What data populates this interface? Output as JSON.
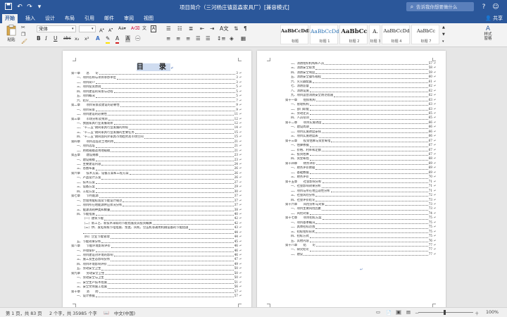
{
  "window": {
    "title": "项目简介（三河杨庄镇蓝森家具厂）[兼容模式]",
    "search_placeholder": "告诉我你想要做什么"
  },
  "tabs": [
    "开始",
    "插入",
    "设计",
    "布局",
    "引用",
    "邮件",
    "审阅",
    "视图"
  ],
  "active_tab": "开始",
  "share_label": "共享",
  "ribbon": {
    "paste_label": "粘贴",
    "font_name": "宋体",
    "font_size": "",
    "format_buttons": [
      "B",
      "I",
      "U",
      "abc",
      "x₂",
      "x²"
    ],
    "styles": [
      {
        "sample": "AaBbCcDdI",
        "name": "标题"
      },
      {
        "sample": "AaBbCcDd",
        "name": "标题 1"
      },
      {
        "sample": "AaBbCc",
        "name": "标题 2"
      },
      {
        "sample": "A.",
        "name": "标题 3"
      },
      {
        "sample": "AaBbCcDd",
        "name": "标题 4"
      },
      {
        "sample": "AaBbCc",
        "name": "标题 7"
      }
    ],
    "side_pane": "样式\n窗格"
  },
  "page1": {
    "title": "目　录",
    "entries": [
      {
        "t": "第一章　　总　　论",
        "p": "3",
        "lv": 0
      },
      {
        "t": "一、项目名称与项目承办单位",
        "p": "3",
        "lv": 1
      },
      {
        "t": "二、项目简介",
        "p": "3",
        "lv": 1
      },
      {
        "t": "三、项目投资原则",
        "p": "5",
        "lv": 1
      },
      {
        "t": "四、项目建设的背景与过程",
        "p": "5",
        "lv": 1
      },
      {
        "t": "五、项目概况",
        "p": "5",
        "lv": 1
      },
      {
        "t": "六、结论",
        "p": "7",
        "lv": 1
      },
      {
        "t": "第二章　　项目背景及建设的必要性",
        "p": "9",
        "lv": 0
      },
      {
        "t": "一、项目背景",
        "p": "9",
        "lv": 1
      },
      {
        "t": "二、项目建设的必要性",
        "p": "11",
        "lv": 1
      },
      {
        "t": "第三章　　市场分析及预测",
        "p": "12",
        "lv": 0
      },
      {
        "t": "一、我国家具行业发展现状",
        "p": "12",
        "lv": 1
      },
      {
        "t": "二、“十二五”期间家具行业发展的目标",
        "p": "14",
        "lv": 1
      },
      {
        "t": "三、“十二五”期间家具行业发展的主要任务",
        "p": "15",
        "lv": 1
      },
      {
        "t": "四、“十二五”期间国内外家具市场趋势及市场空间",
        "p": "15",
        "lv": 1
      },
      {
        "t": "第四章　　项目选址及土地利用",
        "p": "21",
        "lv": 0
      },
      {
        "t": "一、项目选址",
        "p": "21",
        "lv": 1
      },
      {
        "t": "二、用地规模及用地规模",
        "p": "21",
        "lv": 1
      },
      {
        "t": "第五章　　建设规模",
        "p": "23",
        "lv": 0
      },
      {
        "t": "一、建设规模",
        "p": "23",
        "lv": 1
      },
      {
        "t": "二、主要建设内容",
        "p": "24",
        "lv": 1
      },
      {
        "t": "三、总图布置",
        "p": "26",
        "lv": 1
      },
      {
        "t": "第六章　　技术方案、设备方案和工程方案",
        "p": "26",
        "lv": 0
      },
      {
        "t": "一、产品设计方案",
        "p": "26",
        "lv": 1
      },
      {
        "t": "二、技术方案",
        "p": "27",
        "lv": 1
      },
      {
        "t": "三、设备方案",
        "p": "29",
        "lv": 1
      },
      {
        "t": "四、工程方案",
        "p": "30",
        "lv": 1
      },
      {
        "t": "第七章　　节约能源",
        "p": "37",
        "lv": 0
      },
      {
        "t": "一、合理用能标准及节能设计规范",
        "p": "37",
        "lv": 1
      },
      {
        "t": "二、项目所在地能源供应状况分析",
        "p": "37",
        "lv": 1
      },
      {
        "t": "三、能源消耗种类和数量",
        "p": "38",
        "lv": 1
      },
      {
        "t": "四、节能措施",
        "p": "40",
        "lv": 1
      },
      {
        "t": "（一）建筑节能",
        "p": "42",
        "lv": 2
      },
      {
        "t": "（二）新工艺、新技术采取的节能措施及其投资概算",
        "p": "42",
        "lv": 2
      },
      {
        "t": "（三）供、发电系统节电措施、泵类、风机、空压机等通用机械设备的节能措施",
        "p": "43",
        "lv": 2
      },
      {
        "t": "",
        "p": "44",
        "lv": 2
      },
      {
        "t": "（四）企业节能管理",
        "p": "44",
        "lv": 2
      },
      {
        "t": "五、节能效果分析",
        "p": "45",
        "lv": 1
      },
      {
        "t": "第八章　　节能环境影响评价",
        "p": "46",
        "lv": 0
      },
      {
        "t": "一、环境保护",
        "p": "46",
        "lv": 1
      },
      {
        "t": "二、项目建设对环境的影响",
        "p": "46",
        "lv": 1
      },
      {
        "t": "三、施工及生态影响分析",
        "p": "47",
        "lv": 1
      },
      {
        "t": "四、项目环境影响评价",
        "p": "49",
        "lv": 1
      },
      {
        "t": "五、劳动安全卫生",
        "p": "50",
        "lv": 1
      },
      {
        "t": "第九章　　劳动安全卫生",
        "p": "50",
        "lv": 0
      },
      {
        "t": "一、劳动安全与卫生",
        "p": "50",
        "lv": 1
      },
      {
        "t": "二、安全生产技术措施",
        "p": "51",
        "lv": 1
      },
      {
        "t": "三、安全文明施工措施",
        "p": "56",
        "lv": 1
      },
      {
        "t": "第十章　　消　　防",
        "p": "57",
        "lv": 0
      },
      {
        "t": "一、设计依据",
        "p": "57",
        "lv": 1
      }
    ]
  },
  "page2": {
    "entries": [
      {
        "t": "二、消防组织机构和人员",
        "p": "57",
        "lv": 1
      },
      {
        "t": "三、消防安全职责",
        "p": "58",
        "lv": 1
      },
      {
        "t": "四、消防安全制度",
        "p": "59",
        "lv": 1
      },
      {
        "t": "五、消防安全操作规程",
        "p": "60",
        "lv": 1
      },
      {
        "t": "六、灭火器配置",
        "p": "61",
        "lv": 1
      },
      {
        "t": "七、消防监督",
        "p": "62",
        "lv": 1
      },
      {
        "t": "八、消防设施",
        "p": "62",
        "lv": 1
      },
      {
        "t": "九、项目运营消防安全防范措施",
        "p": "62",
        "lv": 1
      },
      {
        "t": "第十一章　　组织机构",
        "p": "63",
        "lv": 0
      },
      {
        "t": "一、管理机构",
        "p": "63",
        "lv": 1
      },
      {
        "t": "二、部门职能",
        "p": "63",
        "lv": 1
      },
      {
        "t": "三、劳动定员",
        "p": "65",
        "lv": 1
      },
      {
        "t": "四、人员培训",
        "p": "65",
        "lv": 1
      },
      {
        "t": "第十二章　　项目实施进度",
        "p": "66",
        "lv": 0
      },
      {
        "t": "一、建设周期",
        "p": "66",
        "lv": 1
      },
      {
        "t": "二、项目实施进度安排",
        "p": "66",
        "lv": 1
      },
      {
        "t": "三、项目实施进度表",
        "p": "66",
        "lv": 1
      },
      {
        "t": "第十三章　　投资估算与资金筹措",
        "p": "67",
        "lv": 0
      },
      {
        "t": "一、估算依据",
        "p": "67",
        "lv": 1
      },
      {
        "t": "二、价格、利率和定额",
        "p": "67",
        "lv": 1
      },
      {
        "t": "三、投资估算",
        "p": "67",
        "lv": 1
      },
      {
        "t": "四、资金筹措",
        "p": "68",
        "lv": 1
      },
      {
        "t": "第十四章　　财务评价",
        "p": "69",
        "lv": 0
      },
      {
        "t": "一、财务评价依据",
        "p": "69",
        "lv": 1
      },
      {
        "t": "二、基础数据",
        "p": "69",
        "lv": 1
      },
      {
        "t": "三、财务评价",
        "p": "70",
        "lv": 1
      },
      {
        "t": "第十五章　　社会影响分析",
        "p": "71",
        "lv": 0
      },
      {
        "t": "一、社会影响效果分析",
        "p": "71",
        "lv": 1
      },
      {
        "t": "二、项目与所在地互适性分析",
        "p": "71",
        "lv": 1
      },
      {
        "t": "三、社会风险分析",
        "p": "72",
        "lv": 1
      },
      {
        "t": "四、社会评价结论",
        "p": "73",
        "lv": 1
      },
      {
        "t": "第十六章　　风险分析与对策",
        "p": "73",
        "lv": 0
      },
      {
        "t": "一、项目主要风险因素",
        "p": "73",
        "lv": 1
      },
      {
        "t": "二、风险对策",
        "p": "74",
        "lv": 1
      },
      {
        "t": "第十七章　　项目招标方案",
        "p": "75",
        "lv": 0
      },
      {
        "t": "一、项目基本概况",
        "p": "75",
        "lv": 1
      },
      {
        "t": "二、具体招标范围",
        "p": "75",
        "lv": 1
      },
      {
        "t": "三、招标组织形式",
        "p": "75",
        "lv": 1
      },
      {
        "t": "四、招标方式",
        "p": "75",
        "lv": 1
      },
      {
        "t": "五、其他内容",
        "p": "76",
        "lv": 1
      },
      {
        "t": "第十八章　　结　　论",
        "p": "77",
        "lv": 0
      },
      {
        "t": "一、研究结论",
        "p": "77",
        "lv": 1
      },
      {
        "t": "二、建议",
        "p": "77",
        "lv": 1
      }
    ]
  },
  "status": {
    "page": "第 1 页，共 83 页",
    "words": "2 个字，共 35985 个字",
    "language": "中文(中国)",
    "zoom": "100%"
  }
}
